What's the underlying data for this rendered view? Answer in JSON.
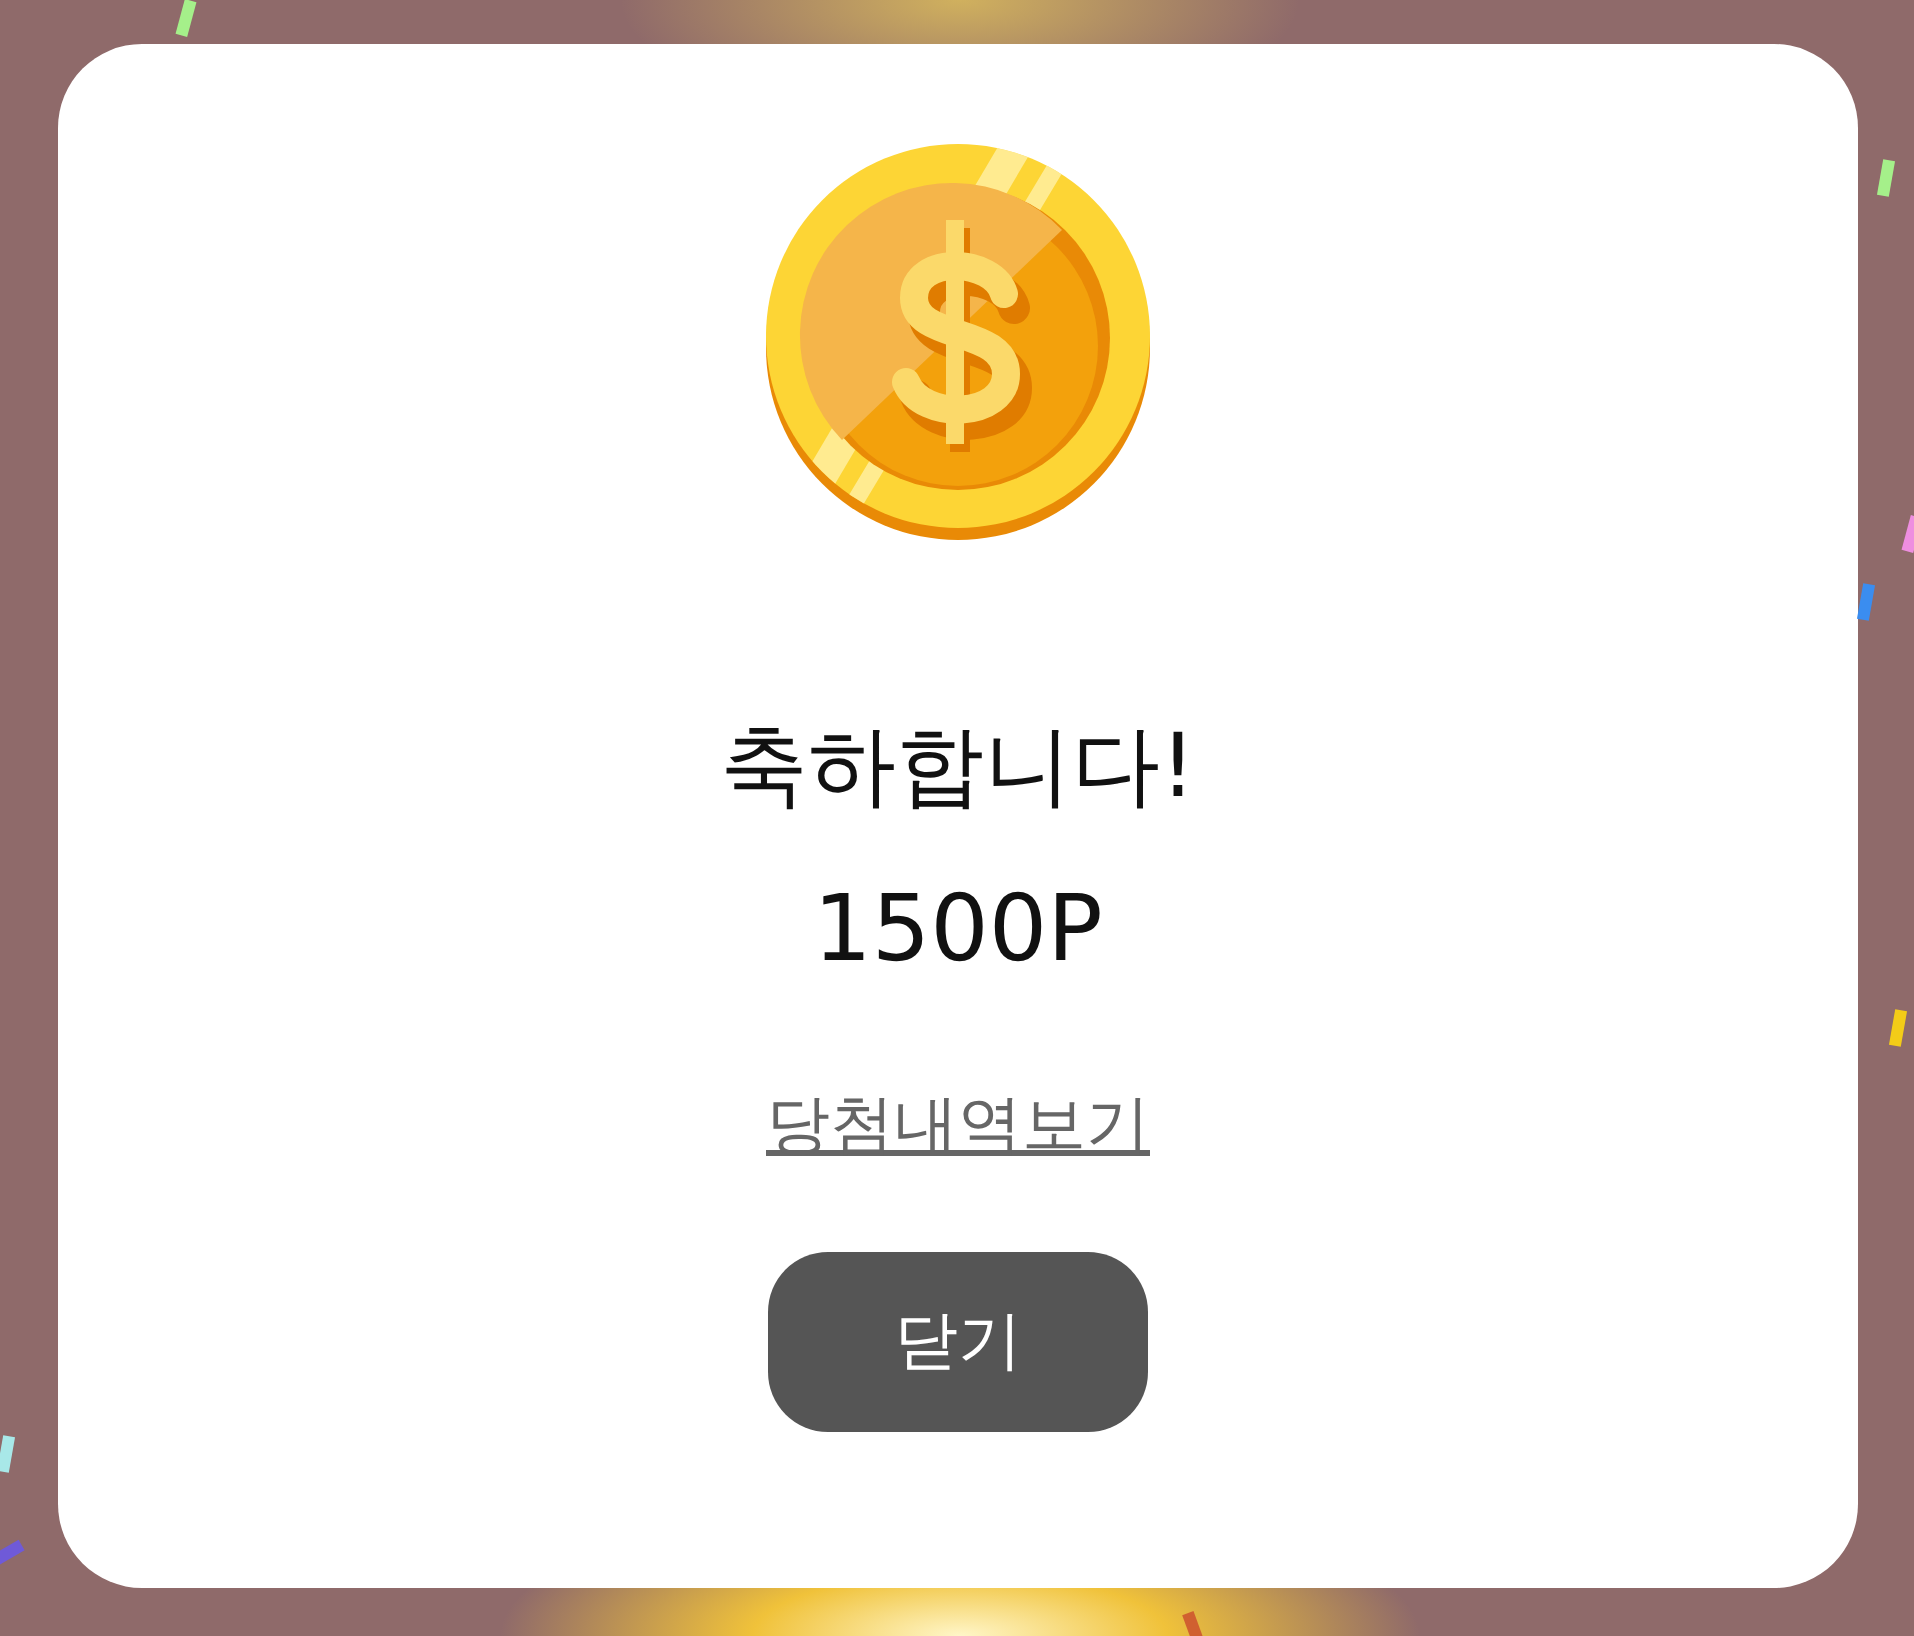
{
  "title": "축하합니다!",
  "prize": "1500P",
  "history_link": "당첨내역보기",
  "close_button": "닫기"
}
